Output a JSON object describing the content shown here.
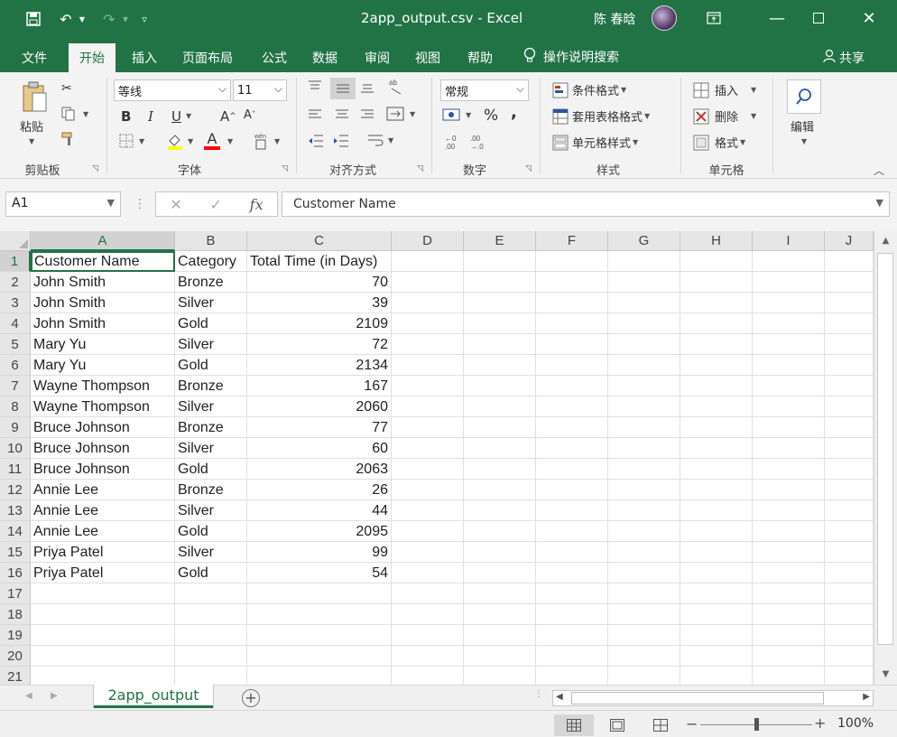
{
  "titlebar": {
    "title": "2app_output.csv  -  Excel",
    "user_name": "陈 春晗"
  },
  "tabs": [
    "文件",
    "开始",
    "插入",
    "页面布局",
    "公式",
    "数据",
    "审阅",
    "视图",
    "帮助"
  ],
  "tell_me": "操作说明搜索",
  "share": "共享",
  "ribbon": {
    "clipboard": {
      "paste": "粘贴",
      "label": "剪贴板"
    },
    "font": {
      "name": "等线",
      "size": "11",
      "label": "字体",
      "bold": "B",
      "italic": "I",
      "underline": "U",
      "grow": "A",
      "shrink": "A",
      "font_color": "A"
    },
    "alignment": {
      "label": "对齐方式"
    },
    "number": {
      "format": "常规",
      "percent": "%",
      "comma": ",",
      "label": "数字"
    },
    "styles": {
      "conditional": "条件格式",
      "table": "套用表格格式",
      "cell": "单元格样式",
      "label": "样式"
    },
    "cells": {
      "insert": "插入",
      "delete": "删除",
      "format": "格式",
      "label": "单元格"
    },
    "editing": {
      "label": "编辑"
    }
  },
  "formula_bar": {
    "name_box": "A1",
    "value": "Customer Name"
  },
  "columns": [
    "A",
    "B",
    "C",
    "D",
    "E",
    "F",
    "G",
    "H",
    "I",
    "J"
  ],
  "rows": [
    [
      "Customer Name",
      "Category",
      "Total Time (in Days)"
    ],
    [
      "John Smith",
      "Bronze",
      "70"
    ],
    [
      "John Smith",
      "Silver",
      "39"
    ],
    [
      "John Smith",
      "Gold",
      "2109"
    ],
    [
      "Mary Yu",
      "Silver",
      "72"
    ],
    [
      "Mary Yu",
      "Gold",
      "2134"
    ],
    [
      "Wayne Thompson",
      "Bronze",
      "167"
    ],
    [
      "Wayne Thompson",
      "Silver",
      "2060"
    ],
    [
      "Bruce Johnson",
      "Bronze",
      "77"
    ],
    [
      "Bruce Johnson",
      "Silver",
      "60"
    ],
    [
      "Bruce Johnson",
      "Gold",
      "2063"
    ],
    [
      "Annie Lee",
      "Bronze",
      "26"
    ],
    [
      "Annie Lee",
      "Silver",
      "44"
    ],
    [
      "Annie Lee",
      "Gold",
      "2095"
    ],
    [
      "Priya Patel",
      "Silver",
      "99"
    ],
    [
      "Priya Patel",
      "Gold",
      "54"
    ],
    [
      "",
      "",
      ""
    ],
    [
      "",
      "",
      ""
    ],
    [
      "",
      "",
      ""
    ],
    [
      "",
      "",
      ""
    ],
    [
      "",
      "",
      ""
    ]
  ],
  "sheet_tab": "2app_output",
  "zoom": "100%",
  "colors": {
    "accent": "#217346"
  }
}
